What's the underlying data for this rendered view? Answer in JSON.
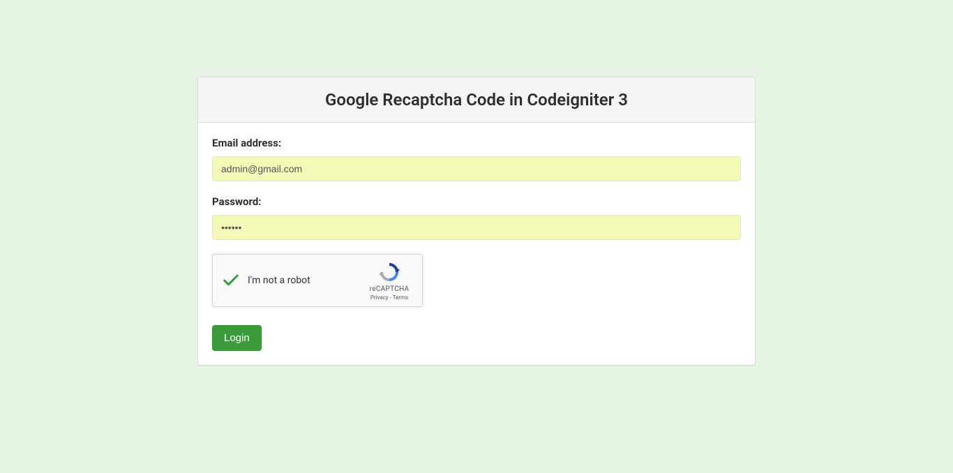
{
  "panel": {
    "title": "Google Recaptcha Code in Codeigniter 3"
  },
  "form": {
    "email_label": "Email address:",
    "email_value": "admin@gmail.com",
    "password_label": "Password:",
    "password_value": "••••••",
    "login_button": "Login"
  },
  "recaptcha": {
    "label": "I'm not a robot",
    "brand": "reCAPTCHA",
    "privacy": "Privacy",
    "terms": "Terms",
    "separator": " - "
  }
}
